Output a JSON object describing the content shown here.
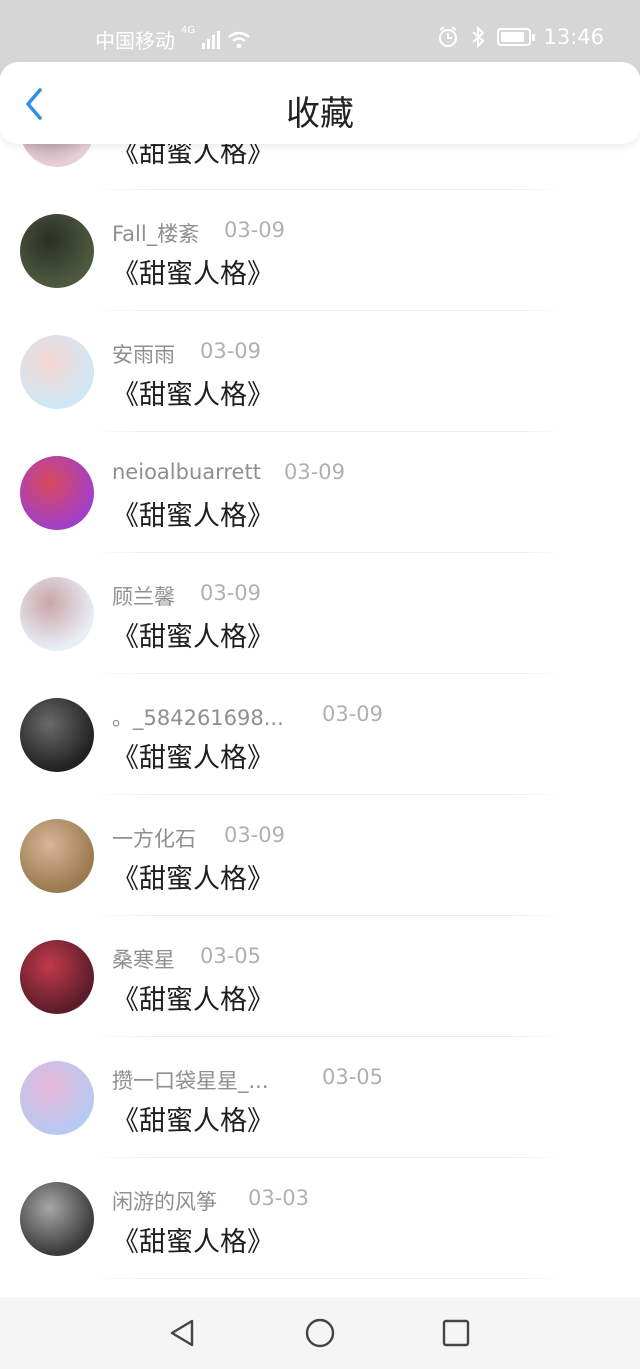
{
  "status_bar": {
    "carrier": "中国移动",
    "network": "4G",
    "time": "13:46",
    "battery_level": 0.85
  },
  "header": {
    "title": "收藏",
    "back_icon": "chevron-left-icon",
    "accent_color": "#2f8ee8"
  },
  "items": [
    {
      "user": "",
      "date": "",
      "title": "《甜蜜人格》",
      "avatar_colors": [
        "#e8cfd6",
        "#9b7f8f"
      ]
    },
    {
      "user": "Fall_楼紊",
      "date": "03-09",
      "title": "《甜蜜人格》",
      "avatar_colors": [
        "#4e5a3f",
        "#2b2f25"
      ]
    },
    {
      "user": "安雨雨",
      "date": "03-09",
      "title": "《甜蜜人格》",
      "avatar_colors": [
        "#cfe8f5",
        "#f6d6d0"
      ]
    },
    {
      "user": "neioalbuarrett",
      "date": "03-09",
      "title": "《甜蜜人格》",
      "avatar_colors": [
        "#a33fc8",
        "#d84a5a"
      ]
    },
    {
      "user": "顾兰馨",
      "date": "03-09",
      "title": "《甜蜜人格》",
      "avatar_colors": [
        "#e9eef6",
        "#c9a6a8"
      ]
    },
    {
      "user": "。_584261698...",
      "date": "03-09",
      "title": "《甜蜜人格》",
      "avatar_colors": [
        "#222222",
        "#6a6a6a"
      ]
    },
    {
      "user": "一方化石",
      "date": "03-09",
      "title": "《甜蜜人格》",
      "avatar_colors": [
        "#9a7a4e",
        "#d7b59a"
      ]
    },
    {
      "user": "桑寒星",
      "date": "03-05",
      "title": "《甜蜜人格》",
      "avatar_colors": [
        "#5b1d2a",
        "#c13a4a"
      ]
    },
    {
      "user": "攒一口袋星星_...",
      "date": "03-05",
      "title": "《甜蜜人格》",
      "avatar_colors": [
        "#b8c9f2",
        "#e8b7d8"
      ]
    },
    {
      "user": "闲游的风筝",
      "date": "03-03",
      "title": "《甜蜜人格》",
      "avatar_colors": [
        "#3b3b3b",
        "#a7a7a7"
      ]
    }
  ],
  "navbar": {
    "back_icon": "triangle-back-icon",
    "home_icon": "circle-home-icon",
    "recents_icon": "square-recents-icon"
  }
}
